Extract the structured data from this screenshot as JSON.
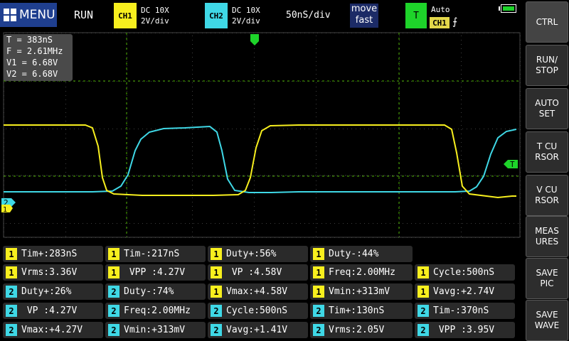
{
  "topbar": {
    "menu_label": "MENU",
    "run_state": "RUN",
    "ch1": {
      "tag": "CH1",
      "coupling": "DC 10X",
      "scale": "2V/div",
      "color": "#f7ef1e"
    },
    "ch2": {
      "tag": "CH2",
      "coupling": "DC 10X",
      "scale": "2V/div",
      "color": "#3fd8e6"
    },
    "timebase": "50nS/div",
    "move_mode": {
      "line1": "move",
      "line2": "fast"
    },
    "trigger": {
      "tag": "T",
      "mode": "Auto",
      "source": "CH1",
      "edge": "rising",
      "color": "#1ed42a"
    },
    "battery_icon": "battery-icon"
  },
  "readout": {
    "t": "T = 383nS",
    "f": "F = 2.61MHz",
    "v1": "V1 = 6.68V",
    "v2": "V2 = 6.68V"
  },
  "markers": {
    "trigger_level": "T",
    "ch2_ground": "2",
    "ch1_ground": "1"
  },
  "side_buttons": [
    {
      "label": "CTRL"
    },
    {
      "label": "RUN/\nSTOP"
    },
    {
      "label": "AUTO\nSET"
    },
    {
      "label": "T CU\nRSOR"
    },
    {
      "label": "V CU\nRSOR"
    },
    {
      "label": "MEAS\nURES"
    },
    {
      "label": "SAVE\nPIC"
    },
    {
      "label": "SAVE\nWAVE"
    }
  ],
  "measurements": [
    [
      {
        "ch": "1",
        "text": "Tim+:283nS"
      },
      {
        "ch": "1",
        "text": "Tim-:217nS"
      },
      {
        "ch": "1",
        "text": "Duty+:56%"
      },
      {
        "ch": "1",
        "text": "Duty-:44%"
      }
    ],
    [
      {
        "ch": "1",
        "text": "Vrms:3.36V"
      },
      {
        "ch": "1",
        "text": " VPP :4.27V"
      },
      {
        "ch": "1",
        "text": " VP :4.58V"
      },
      {
        "ch": "1",
        "text": "Freq:2.00MHz"
      },
      {
        "ch": "1",
        "text": "Cycle:500nS"
      }
    ],
    [
      {
        "ch": "2",
        "text": "Duty+:26%"
      },
      {
        "ch": "2",
        "text": "Duty-:74%"
      },
      {
        "ch": "1",
        "text": "Vmax:+4.58V"
      },
      {
        "ch": "1",
        "text": "Vmin:+313mV"
      },
      {
        "ch": "1",
        "text": "Vavg:+2.74V"
      }
    ],
    [
      {
        "ch": "2",
        "text": " VP :4.27V"
      },
      {
        "ch": "2",
        "text": "Freq:2.00MHz"
      },
      {
        "ch": "2",
        "text": "Cycle:500nS"
      },
      {
        "ch": "2",
        "text": "Tim+:130nS"
      },
      {
        "ch": "2",
        "text": "Tim-:370nS"
      }
    ],
    [
      {
        "ch": "2",
        "text": "Vmax:+4.27V"
      },
      {
        "ch": "2",
        "text": "Vmin:+313mV"
      },
      {
        "ch": "2",
        "text": "Vavg:+1.41V"
      },
      {
        "ch": "2",
        "text": "Vrms:2.05V"
      },
      {
        "ch": "2",
        "text": " VPP :3.95V"
      }
    ]
  ]
}
